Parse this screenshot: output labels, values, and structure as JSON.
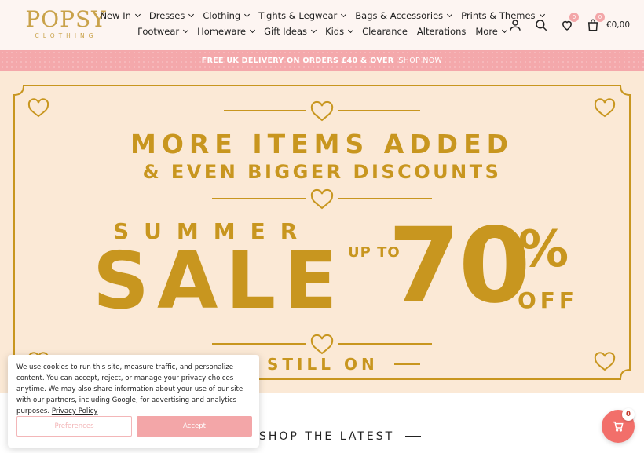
{
  "brand": {
    "name": "POPSY",
    "sub": "CLOTHING"
  },
  "nav": {
    "row1": [
      {
        "label": "New In",
        "has_dropdown": true
      },
      {
        "label": "Dresses",
        "has_dropdown": true
      },
      {
        "label": "Clothing",
        "has_dropdown": true
      },
      {
        "label": "Tights & Legwear",
        "has_dropdown": true
      },
      {
        "label": "Bags & Accessories",
        "has_dropdown": true
      },
      {
        "label": "Prints & Themes",
        "has_dropdown": true
      }
    ],
    "row2": [
      {
        "label": "Footwear",
        "has_dropdown": true
      },
      {
        "label": "Homeware",
        "has_dropdown": true
      },
      {
        "label": "Gift Ideas",
        "has_dropdown": true
      },
      {
        "label": "Kids",
        "has_dropdown": true
      },
      {
        "label": "Clearance",
        "has_dropdown": false
      },
      {
        "label": "Alterations",
        "has_dropdown": false
      },
      {
        "label": "More",
        "has_dropdown": true
      }
    ]
  },
  "header_icons": {
    "account": "account-icon",
    "search": "search-icon",
    "wishlist": "heart-icon",
    "wishlist_count": "0",
    "cart": "bag-icon",
    "cart_count": "0",
    "cart_total": "€0,00"
  },
  "promo": {
    "text": "FREE UK DELIVERY ON ORDERS £40 & OVER",
    "link": "SHOP NOW"
  },
  "hero": {
    "line1": "MORE ITEMS ADDED",
    "line2": "& EVEN BIGGER DISCOUNTS",
    "summer": "SUMMER",
    "sale": "SALE",
    "up_to": "UP TO",
    "percent_value": "70",
    "percent_sign": "%",
    "off": "OFF",
    "still_on": "STILL ON"
  },
  "section": {
    "title": "SHOP THE LATEST"
  },
  "cookie": {
    "text": "We use cookies to run this site, measure traffic, and personalize content. You can accept, reject, or manage your privacy choices anytime. We may also share information about your use of our site with our partners, including Google, for advertising and analytics purposes.",
    "link": "Privacy Policy",
    "preferences": "Preferences",
    "accept": "Accept"
  },
  "floating_cart": {
    "count": "0"
  },
  "colors": {
    "gold": "#c8961f",
    "pink": "#f4a8ab",
    "hero_bg": "#fbe9d6",
    "header_bg": "#fdf5f2",
    "fab": "#f26f6a"
  }
}
